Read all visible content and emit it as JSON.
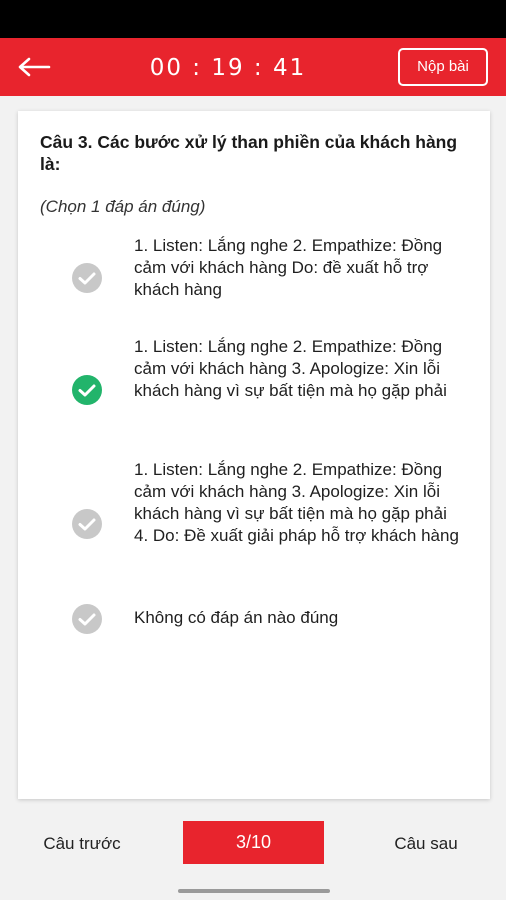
{
  "header": {
    "timer": "00 : 19 : 41",
    "submit_label": "Nộp bài",
    "back_icon": "arrow-left-icon",
    "color": "#e8242d"
  },
  "question": {
    "title": "Câu 3. Các bước xử lý than phiền của khách hàng là:",
    "instruction": "(Chọn 1 đáp án đúng)",
    "options": [
      {
        "text": "1. Listen: Lắng nghe 2. Empathize: Đồng cảm với khách hàng Do: đề xuất hỗ trợ khách hàng",
        "selected": false
      },
      {
        "text": "1. Listen: Lắng nghe 2. Empathize: Đồng cảm với khách hàng 3. Apologize: Xin lỗi khách hàng vì sự bất tiện mà họ gặp phải",
        "selected": true
      },
      {
        "text": "1. Listen: Lắng nghe 2. Empathize: Đồng cảm với khách hàng 3. Apologize: Xin lỗi khách hàng vì sự bất tiện mà họ gặp phải 4. Do: Đề xuất giải pháp hỗ trợ khách hàng",
        "selected": false
      },
      {
        "text": "Không có đáp án nào đúng",
        "selected": false
      }
    ],
    "check_icon": "check-circle-icon",
    "selected_color": "#22b46b",
    "unselected_color": "#c8c8c8"
  },
  "footer": {
    "prev_label": "Câu trước",
    "page_label": "3/10",
    "next_label": "Câu sau"
  }
}
